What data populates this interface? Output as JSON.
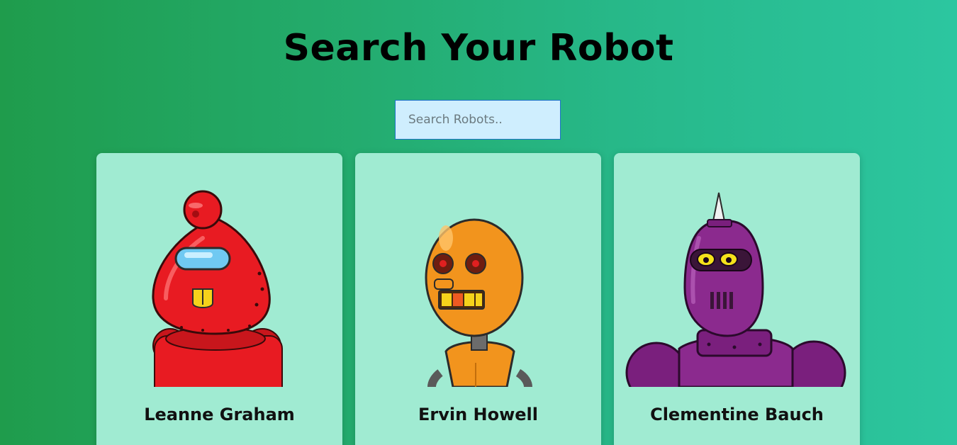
{
  "header": {
    "title": "Search Your Robot"
  },
  "search": {
    "placeholder": "Search Robots..",
    "value": ""
  },
  "robots": [
    {
      "name": "Leanne Graham",
      "color": "#e81b22"
    },
    {
      "name": "Ervin Howell",
      "color": "#f2941d"
    },
    {
      "name": "Clementine Bauch",
      "color": "#8b2a8e"
    }
  ]
}
